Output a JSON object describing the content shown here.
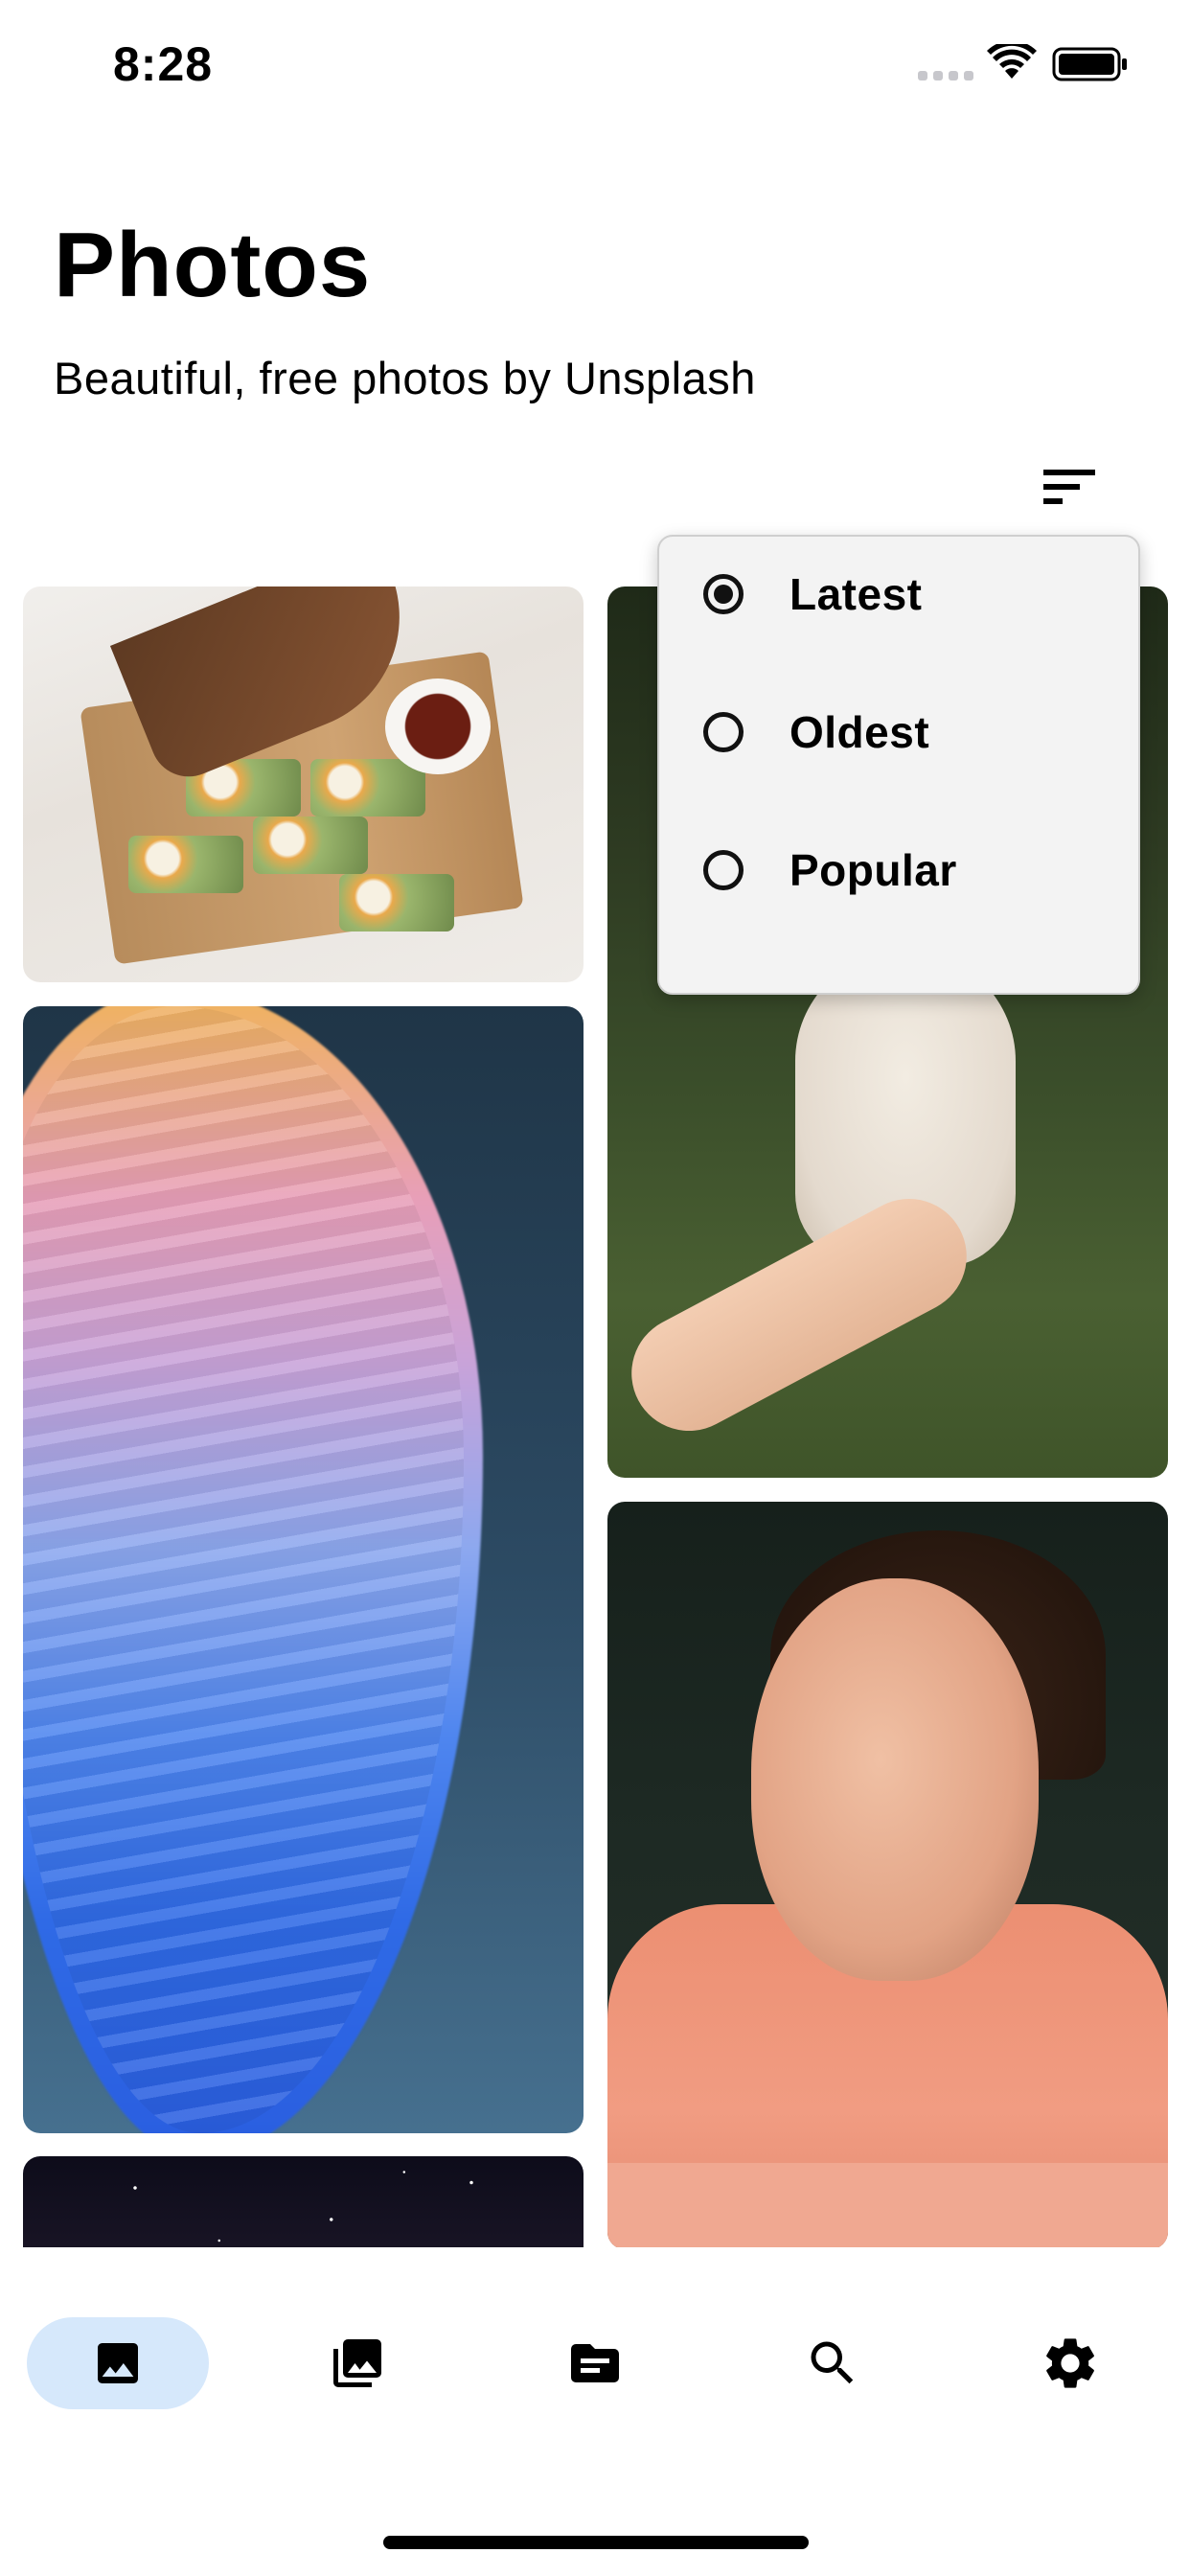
{
  "status_bar": {
    "time": "8:28"
  },
  "header": {
    "title": "Photos",
    "subtitle": "Beautiful, free photos by Unsplash"
  },
  "toolbar": {
    "sort_icon": "sort-icon"
  },
  "sort_menu": {
    "selected": "Latest",
    "options": [
      {
        "label": "Latest",
        "selected": true
      },
      {
        "label": "Oldest",
        "selected": false
      },
      {
        "label": "Popular",
        "selected": false
      }
    ]
  },
  "photos": [
    {
      "subject": "avocado toast on wooden board"
    },
    {
      "subject": "dog giving paw to hand"
    },
    {
      "subject": "colorful abstract 3D wave"
    },
    {
      "subject": "woman in coral shirt resting chin on hand"
    },
    {
      "subject": "starry night sky"
    }
  ],
  "bottom_nav": {
    "active": "photos",
    "items": [
      {
        "id": "photos",
        "icon": "image-icon"
      },
      {
        "id": "collections",
        "icon": "photo-library-icon"
      },
      {
        "id": "files",
        "icon": "folder-icon"
      },
      {
        "id": "search",
        "icon": "search-icon"
      },
      {
        "id": "settings",
        "icon": "gear-icon"
      }
    ]
  },
  "colors": {
    "nav_active_bg": "#d6e8fb",
    "menu_bg": "#f3f3f3"
  }
}
